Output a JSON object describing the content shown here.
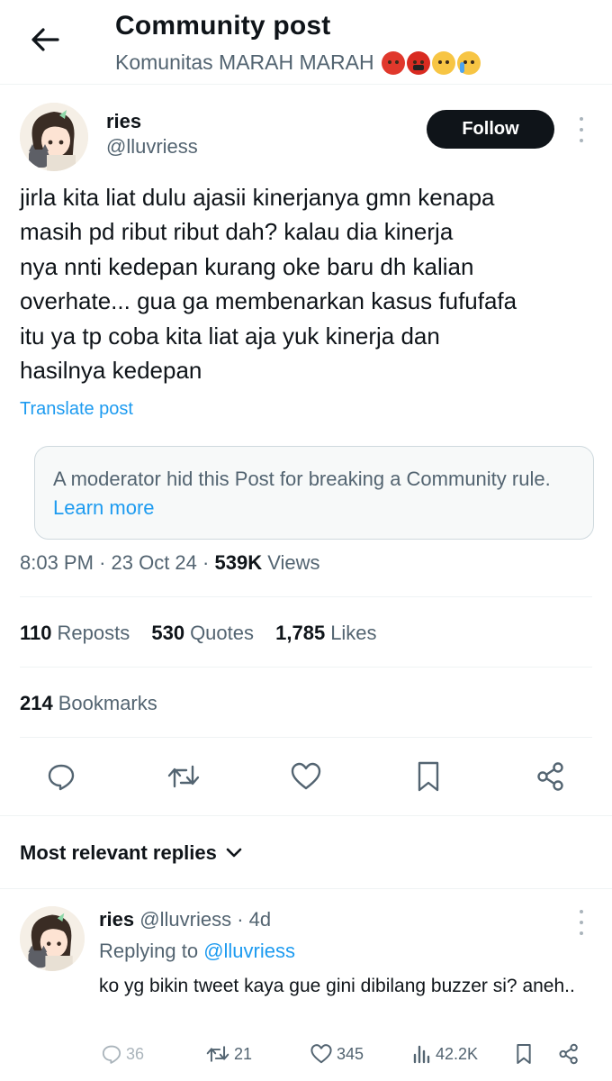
{
  "header": {
    "title": "Community post",
    "community_name": "Komunitas MARAH MARAH",
    "emojis": [
      "angry-face",
      "face-with-symbols-on-mouth",
      "face-with-steam",
      "loudly-crying-face"
    ]
  },
  "post": {
    "author_name": "ries",
    "author_handle": "@lluvriess",
    "follow_label": "Follow",
    "text_lines": [
      "jirla kita liat dulu ajasii kinerjanya gmn kenapa",
      "masih pd ribut ribut dah? kalau dia kinerja",
      "nya nnti kedepan kurang oke baru dh kalian",
      "overhate... gua ga membenarkan kasus fufufafa",
      "itu ya tp coba kita liat aja yuk kinerja dan",
      "hasilnya kedepan"
    ],
    "translate_label": "Translate post",
    "moderator_notice": "A moderator hid this Post for breaking a Community rule.",
    "learn_more": "Learn more",
    "time": "8:03 PM",
    "date": "23 Oct 24",
    "views_count": "539K",
    "views_label": "Views",
    "reposts_count": "110",
    "reposts_label": "Reposts",
    "quotes_count": "530",
    "quotes_label": "Quotes",
    "likes_count": "1,785",
    "likes_label": "Likes",
    "bookmarks_count": "214",
    "bookmarks_label": "Bookmarks"
  },
  "replies": {
    "sort_label": "Most relevant replies",
    "items": [
      {
        "author_name": "ries",
        "author_handle": "@lluvriess",
        "age": "4d",
        "replying_prefix": "Replying to",
        "replying_to": "@lluvriess",
        "text": "ko yg bikin tweet kaya gue gini dibilang buzzer si? aneh..",
        "reply_count": "36",
        "repost_count": "21",
        "like_count": "345",
        "view_count": "42.2K"
      }
    ]
  },
  "colors": {
    "link": "#1d9bf0",
    "secondary_text": "#536471",
    "primary_text": "#0f1419",
    "follow_bg": "#0f1419"
  }
}
